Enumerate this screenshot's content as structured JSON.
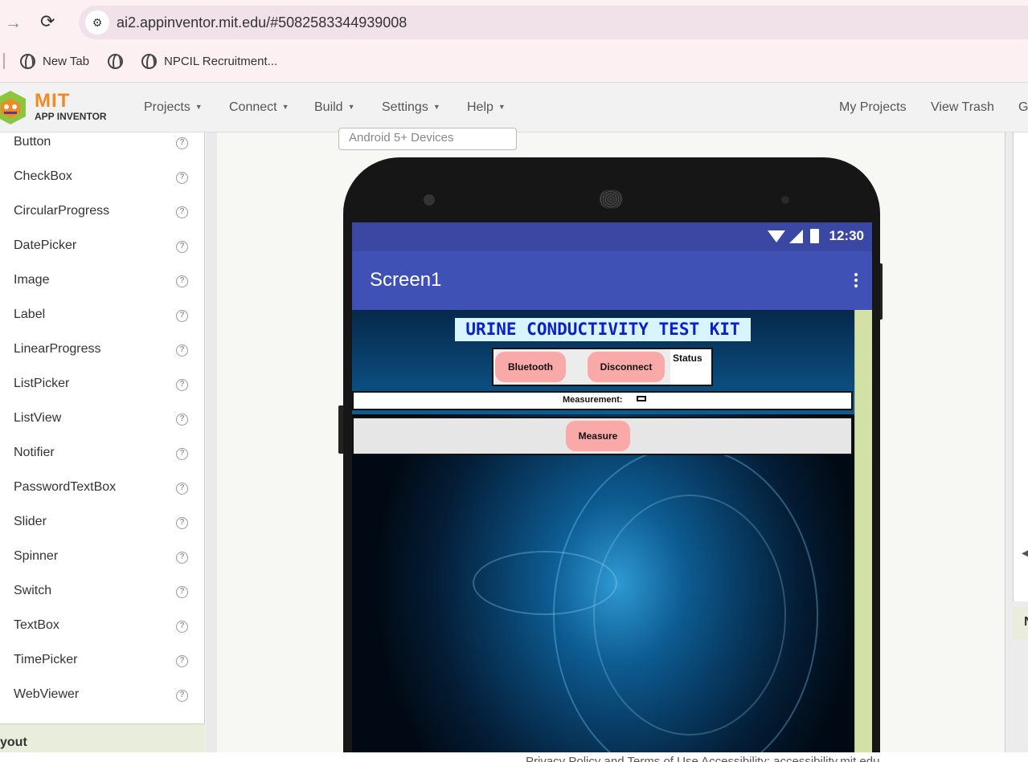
{
  "browser": {
    "url": "ai2.appinventor.mit.edu/#5082583344939008",
    "bookmarks": [
      "New Tab",
      "",
      "NPCIL Recruitment..."
    ]
  },
  "appbar": {
    "logo_title": "MIT",
    "logo_subtitle": "APP INVENTOR",
    "menus": [
      "Projects",
      "Connect",
      "Build",
      "Settings",
      "Help"
    ],
    "right_links": [
      "My Projects",
      "View Trash",
      "G"
    ]
  },
  "palette": {
    "items": [
      "Button",
      "CheckBox",
      "CircularProgress",
      "DatePicker",
      "Image",
      "Label",
      "LinearProgress",
      "ListPicker",
      "ListView",
      "Notifier",
      "PasswordTextBox",
      "Slider",
      "Spinner",
      "Switch",
      "TextBox",
      "TimePicker",
      "WebViewer"
    ],
    "help_glyph": "?",
    "section_label": "yout"
  },
  "viewer": {
    "device_select": "Android 5+ Devices",
    "right_tab_label": "N"
  },
  "phone": {
    "time": "12:30",
    "screen_title": "Screen1",
    "app_title": "URINE CONDUCTIVITY TEST KIT",
    "bluetooth_label": "Bluetooth",
    "disconnect_label": "Disconnect",
    "status_label": "Status",
    "measurement_label": "Measurement:",
    "measure_label": "Measure"
  },
  "footer": {
    "text": "Privacy Policy and Terms of Use      Accessibility: accessibility.mit.edu"
  },
  "colors": {
    "statusbar": "#3a47a3",
    "titlebar": "#3f51b5",
    "button_pink": "#f9a9a7",
    "app_title_text": "#0b20c8",
    "logo_orange": "#f08a24"
  }
}
